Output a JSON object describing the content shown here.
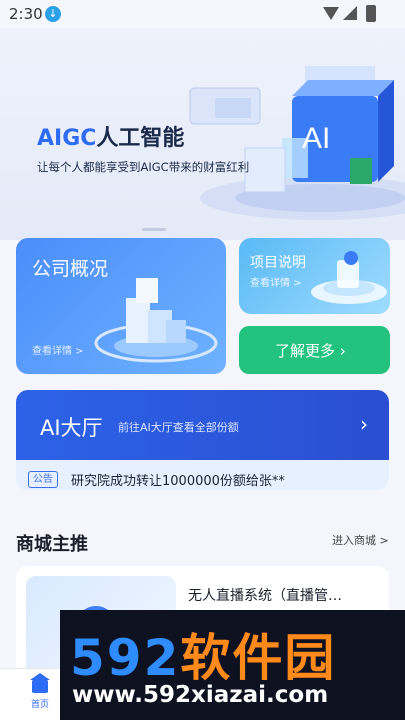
{
  "status_bar": {
    "time": "2:30"
  },
  "banner": {
    "title_accent": "AIGC",
    "title_rest": "人工智能",
    "subtitle": "让每个人都能享受到AIGC带来的财富红利",
    "cube_label": "AI"
  },
  "cards": {
    "company": {
      "title": "公司概况",
      "link": "查看详情 >"
    },
    "project": {
      "title": "项目说明",
      "link": "查看详情 >"
    },
    "more": {
      "title": "了解更多 ›"
    }
  },
  "ai_hall": {
    "title": "AI大厅",
    "subtitle": "前往AI大厅查看全部份额",
    "notice_badge": "公告",
    "notice_text": "研究院成功转让1000000份额给张**"
  },
  "mall": {
    "section_title": "商城主推",
    "section_link": "进入商城 >",
    "product_name": "无人直播系统（直播管…"
  },
  "tabbar": {
    "home_label": "首页"
  },
  "watermark": {
    "brand_num": "592",
    "brand_text": "软件园",
    "url": "www.592xiazai.com"
  },
  "colors": {
    "primary": "#2f6cf5",
    "green": "#23c27e",
    "watermark_orange": "#ff8a1a"
  }
}
